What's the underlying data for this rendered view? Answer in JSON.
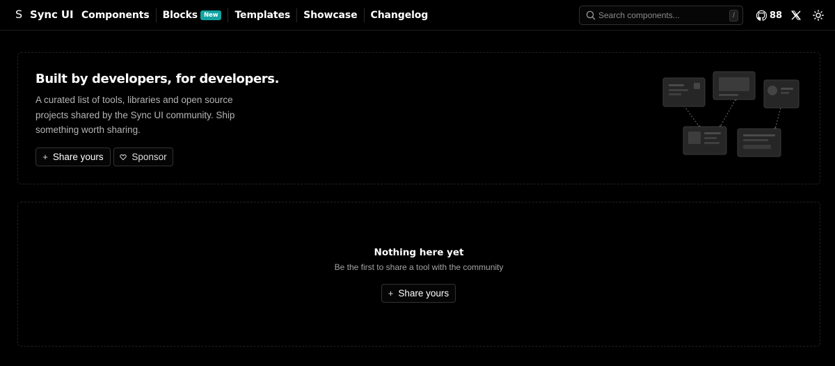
{
  "header": {
    "logo_mark": "S",
    "logo_text": "Sync UI",
    "nav": [
      {
        "label": "Components"
      },
      {
        "label": "Blocks",
        "badge": "New"
      },
      {
        "label": "Templates"
      },
      {
        "label": "Showcase"
      },
      {
        "label": "Changelog"
      }
    ],
    "search": {
      "placeholder": "Search components...",
      "shortcut": "/"
    },
    "github_stars": "88",
    "icons": [
      "github-icon",
      "x-icon",
      "sun-icon",
      "search-icon"
    ]
  },
  "hero": {
    "title": "Built by developers, for developers.",
    "description": "A curated list of tools, libraries and open source projects shared by the Sync UI community. Ship something worth sharing.",
    "share_button": "Share yours",
    "sponsor_button": "Sponsor",
    "icons": [
      "plus-icon",
      "heart-icon"
    ]
  },
  "empty_state": {
    "title": "Nothing here yet",
    "subtitle": "Be the first to share a tool with the community",
    "button": "Share yours"
  },
  "colors": {
    "background": "#000000",
    "badge": "#12a3a0",
    "border": "#222222",
    "muted_text": "#b5b5b5"
  }
}
